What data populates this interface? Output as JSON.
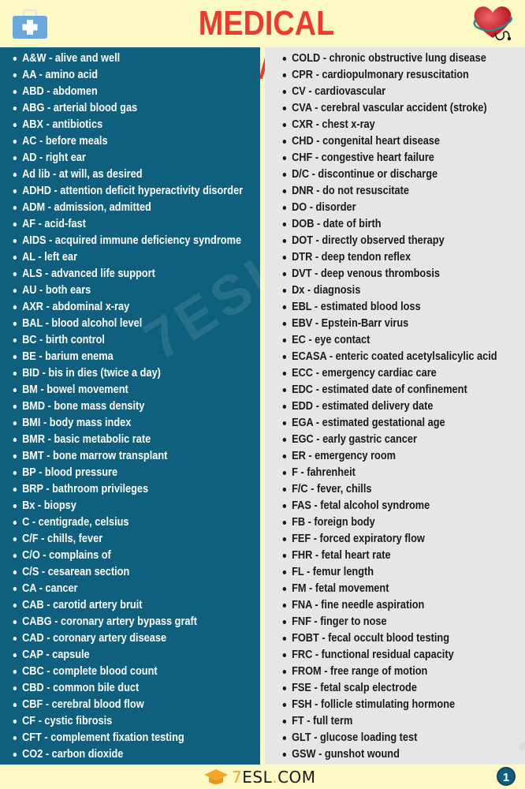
{
  "header": {
    "title": "MEDICAL ABBREVIATIONS",
    "left_icon": "first-aid-kit-icon",
    "right_icon": "heart-stethoscope-icon"
  },
  "colors": {
    "title": "#ec3a2e",
    "background": "#fdf9c4",
    "left_panel": "#0f5f7f",
    "right_panel": "#e6e6e6",
    "logo_accent": "#f4a62a"
  },
  "left_column": [
    "A&W - alive and well",
    "AA - amino acid",
    "ABD - abdomen",
    "ABG - arterial blood gas",
    "ABX - antibiotics",
    "AC - before meals",
    "AD - right ear",
    "Ad lib - at will, as desired",
    "ADHD - attention deficit hyperactivity disorder",
    "ADM - admission, admitted",
    "AF - acid-fast",
    "AIDS - acquired immune deficiency syndrome",
    "AL - left ear",
    "ALS - advanced life support",
    "AU - both ears",
    "AXR - abdominal x-ray",
    "BAL - blood alcohol level",
    "BC - birth control",
    "BE - barium enema",
    "BID - bis in dies (twice a day)",
    "BM - bowel movement",
    "BMD - bone mass density",
    "BMI - body mass index",
    "BMR - basic metabolic rate",
    "BMT - bone marrow transplant",
    "BP - blood pressure",
    "BRP - bathroom privileges",
    "Bx - biopsy",
    "C - centigrade, celsius",
    "C/F - chills, fever",
    "C/O - complains of",
    "C/S - cesarean section",
    "CA - cancer",
    "CAB - carotid artery bruit",
    "CABG - coronary artery bypass graft",
    "CAD - coronary artery disease",
    "CAP - capsule",
    "CBC - complete blood count",
    "CBD - common bile duct",
    "CBF - cerebral blood flow",
    "CF - cystic fibrosis",
    "CFT - complement fixation testing",
    "CO2 - carbon dioxide"
  ],
  "right_column": [
    "COLD - chronic obstructive lung disease",
    "CPR - cardiopulmonary resuscitation",
    "CV - cardiovascular",
    "CVA - cerebral vascular accident (stroke)",
    "CXR - chest x-ray",
    "CHD - congenital heart disease",
    "CHF - congestive heart failure",
    "D/C - discontinue or discharge",
    "DNR - do not resuscitate",
    "DO - disorder",
    "DOB - date of birth",
    "DOT - directly observed therapy",
    "DTR - deep tendon reflex",
    "DVT - deep venous thrombosis",
    "Dx - diagnosis",
    "EBL - estimated blood loss",
    "EBV - Epstein-Barr virus",
    "EC - eye contact",
    "ECASA - enteric coated acetylsalicylic acid",
    "ECC - emergency cardiac care",
    "EDC - estimated date of confinement",
    "EDD - estimated delivery date",
    "EGA - estimated gestational age",
    "EGC - early gastric cancer",
    "ER - emergency room",
    "F - fahrenheit",
    "F/C - fever, chills",
    "FAS - fetal alcohol syndrome",
    "FB - foreign body",
    "FEF - forced expiratory flow",
    "FHR - fetal heart rate",
    "FL - femur length",
    "FM - fetal movement",
    "FNA - fine needle aspiration",
    "FNF - finger to nose",
    "FOBT - fecal occult blood testing",
    "FRC - functional residual capacity",
    "FROM - free range of motion",
    "FSE - fetal scalp electrode",
    "FSH - follicle stimulating hormone",
    "FT - full term",
    "GLT - glucose loading test",
    "GSW - gunshot wound"
  ],
  "watermark": {
    "text": "7ESL.COM"
  },
  "footer": {
    "logo_seven": "7",
    "logo_main": "ESL",
    "logo_dot": ".",
    "logo_tld": "COM",
    "logo_icon": "graduation-cap-icon",
    "page_number": "1"
  }
}
